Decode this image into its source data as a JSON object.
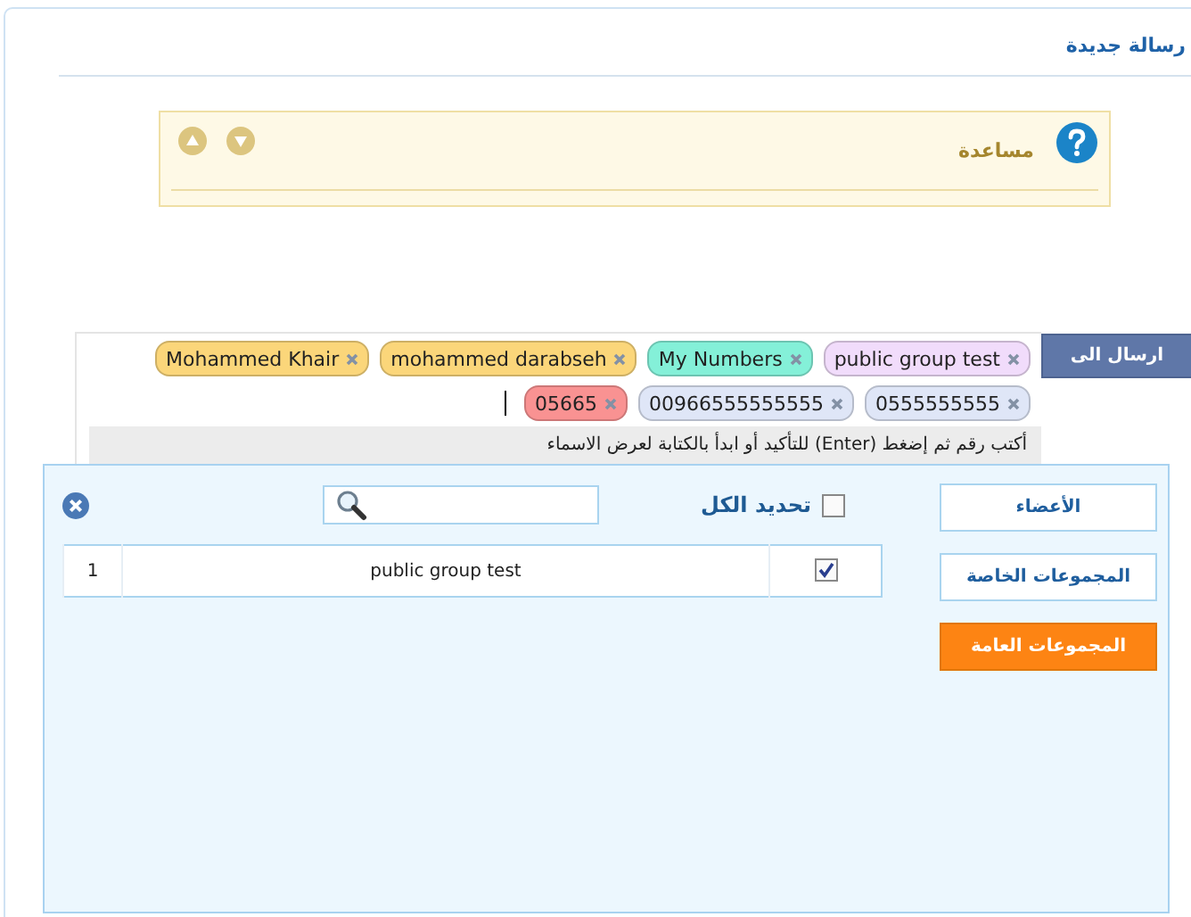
{
  "page": {
    "title": "رسالة جديدة"
  },
  "help": {
    "title": "مساعدة"
  },
  "send": {
    "button": "ارسال الى",
    "recipient_rows": [
      [
        {
          "label": "public group test",
          "color": "#f1dcfb"
        },
        {
          "label": "My Numbers",
          "color": "#84f0d8"
        },
        {
          "label": "mohammed darabseh",
          "color": "#fbd67a"
        },
        {
          "label": "Mohammed Khair",
          "color": "#fbd67a"
        }
      ],
      [
        {
          "label": "0555555555",
          "color": "#dfe6f7"
        },
        {
          "label": "00966555555555",
          "color": "#dfe6f7"
        },
        {
          "label": "05665",
          "color": "#f99292"
        }
      ]
    ],
    "hint": "أكتب رقم ثم إضغط (Enter) للتأكيد أو ابدأ بالكتابة لعرض الاسماء"
  },
  "picker": {
    "tabs": [
      {
        "label": "الأعضاء",
        "selected": false
      },
      {
        "label": "المجموعات الخاصة",
        "selected": false
      },
      {
        "label": "المجموعات العامة",
        "selected": true
      }
    ],
    "select_all": {
      "label": "تحديد الكل",
      "checked": false
    },
    "rows": [
      {
        "checked": true,
        "name": "public group test",
        "index": "1"
      }
    ]
  }
}
